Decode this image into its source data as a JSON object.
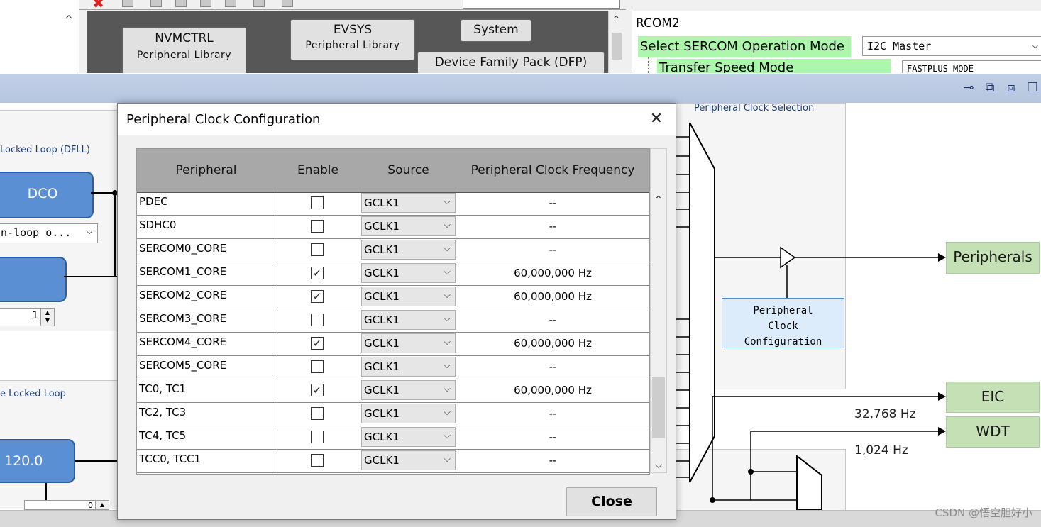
{
  "background": {
    "project": {
      "nvmctrl_title": "NVMCTRL",
      "nvmctrl_sub": "Peripheral Library",
      "evsys_title": "EVSYS",
      "evsys_sub": "Peripheral Library",
      "system_label": "System",
      "dfp_label": "Device Family Pack (DFP)"
    },
    "config": {
      "header": "RCOM2",
      "mode_label": "Select SERCOM Operation Mode",
      "mode_value": "I2C Master",
      "speed_label": "Transfer Speed Mode",
      "speed_value": "FASTPLUS_MODE"
    }
  },
  "clock": {
    "dfll_label": "Locked Loop (DFLL)",
    "dco_label": "DCO",
    "loop_combo": "n-loop o...",
    "spin_value": "1",
    "pll_label": "e Locked Loop",
    "pll_value": "120.0",
    "pll_spin_value": "0",
    "pcs_label": "Peripheral Clock Selection",
    "pcc_line1": "Peripheral",
    "pcc_line2": "Clock",
    "pcc_line3": "Configuration",
    "peripherals_label": "Peripherals",
    "eic_label": "EIC",
    "wdt_label": "WDT",
    "freq_32k": "32,768 Hz",
    "freq_1k": "1,024 Hz"
  },
  "dialog": {
    "title": "Peripheral Clock Configuration",
    "close_button": "Close",
    "columns": [
      "Peripheral",
      "Enable",
      "Source",
      "Peripheral Clock Frequency"
    ],
    "rows": [
      {
        "name": "PDEC",
        "enabled": false,
        "source": "GCLK1",
        "freq": "--"
      },
      {
        "name": "SDHC0",
        "enabled": false,
        "source": "GCLK1",
        "freq": "--"
      },
      {
        "name": "SERCOM0_CORE",
        "enabled": false,
        "source": "GCLK1",
        "freq": "--"
      },
      {
        "name": "SERCOM1_CORE",
        "enabled": true,
        "source": "GCLK1",
        "freq": "60,000,000 Hz"
      },
      {
        "name": "SERCOM2_CORE",
        "enabled": true,
        "source": "GCLK1",
        "freq": "60,000,000 Hz"
      },
      {
        "name": "SERCOM3_CORE",
        "enabled": false,
        "source": "GCLK1",
        "freq": "--"
      },
      {
        "name": "SERCOM4_CORE",
        "enabled": true,
        "source": "GCLK1",
        "freq": "60,000,000 Hz"
      },
      {
        "name": "SERCOM5_CORE",
        "enabled": false,
        "source": "GCLK1",
        "freq": "--"
      },
      {
        "name": "TC0, TC1",
        "enabled": true,
        "source": "GCLK1",
        "freq": "60,000,000 Hz"
      },
      {
        "name": "TC2, TC3",
        "enabled": false,
        "source": "GCLK1",
        "freq": "--"
      },
      {
        "name": "TC4, TC5",
        "enabled": false,
        "source": "GCLK1",
        "freq": "--"
      },
      {
        "name": "TCC0, TCC1",
        "enabled": false,
        "source": "GCLK1",
        "freq": "--"
      }
    ]
  },
  "watermark": "CSDN @悟空胆好小",
  "icons": {
    "close": "close-icon",
    "check": "checkmark-icon",
    "dropdown": "chevron-down-icon",
    "scroll_up": "chevron-up-icon",
    "scroll_down": "chevron-down-icon",
    "pin": "pin-icon",
    "export": "export-icon",
    "layers": "layers-icon",
    "window": "window-icon"
  },
  "colors": {
    "green_highlight": "#adf7ad",
    "output_green": "#c5e0b4",
    "node_blue": "#5b8fd4",
    "header_gray": "#a8a8a8"
  }
}
